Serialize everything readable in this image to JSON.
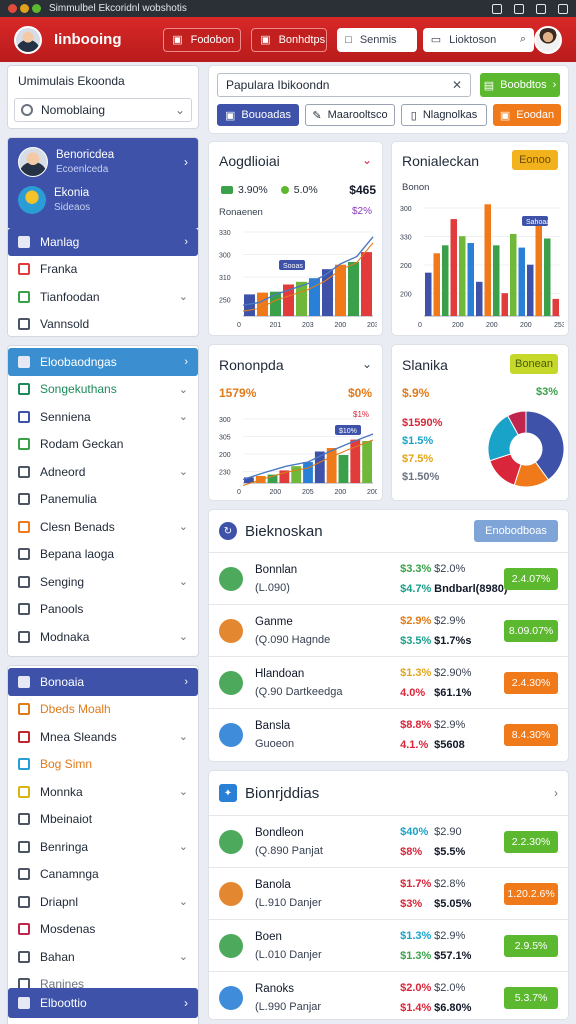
{
  "window": {
    "title": "Simmulbel Ekcoridnl wobshotis"
  },
  "header": {
    "app_title": "Iinbooing",
    "btn1": "Fodobon",
    "btn2": "Bonhdtps",
    "field1": "Senmis",
    "field2": "Lioktoson"
  },
  "sidebar": {
    "box1_title": "Umimulais Ekoonda",
    "box1_select": "Nomoblaing",
    "profile1_name": "Benoricdea",
    "profile1_sub": "Ecoenlceda",
    "profile2_name": "Ekonia",
    "profile2_sub": "Sideaos",
    "items_a": [
      {
        "label": "Manlag",
        "icon": "map-icon",
        "color": "#ffffff",
        "active": true
      },
      {
        "label": "Franka",
        "icon": "flag-icon",
        "color": "#e23b3b"
      },
      {
        "label": "Tianfoodan",
        "icon": "chart-icon",
        "color": "#3aa14a"
      },
      {
        "label": "Vannsold",
        "icon": "clock-icon",
        "color": "#4b5563"
      }
    ],
    "items_b": [
      {
        "label": "Eloobaodngas",
        "icon": "folder-icon",
        "active": true
      },
      {
        "label": "Songekuthans",
        "icon": "leaf-icon",
        "color": "#1e8a5a",
        "green": true
      },
      {
        "label": "Senniena",
        "icon": "home-icon",
        "color": "#3d52a8"
      },
      {
        "label": "Rodam Geckan",
        "icon": "star-icon",
        "color": "#3aa14a"
      },
      {
        "label": "Adneord",
        "icon": "doc-icon",
        "color": "#4b5563"
      },
      {
        "label": "Panemulia",
        "icon": "doc-icon",
        "color": "#4b5563"
      },
      {
        "label": "Clesn Benads",
        "icon": "dot-icon",
        "color": "#f07a1a"
      },
      {
        "label": "Bepana laoga",
        "icon": "doc-icon",
        "color": "#4b5563"
      },
      {
        "label": "Senging",
        "icon": "cart-icon",
        "color": "#4b5563"
      },
      {
        "label": "Panools",
        "icon": "info-icon",
        "color": "#4b5563"
      },
      {
        "label": "Modnaka",
        "icon": "grid-icon",
        "color": "#4b5563"
      }
    ],
    "items_c": [
      {
        "label": "Bonoaia",
        "icon": "folder-icon",
        "active": true
      },
      {
        "label": "Dbeds Moalh",
        "icon": "tag-icon",
        "color": "#e07b1a",
        "orange": true
      },
      {
        "label": "Mnea Sleands",
        "icon": "flag-icon",
        "color": "#c0262d"
      },
      {
        "label": "Bog Simn",
        "icon": "mail-icon",
        "color": "#2a9dd6",
        "orange": true
      },
      {
        "label": "Monnka",
        "icon": "dot-icon",
        "color": "#d9b51a"
      },
      {
        "label": "Mbeinaiot",
        "icon": "doc-icon",
        "color": "#4b5563"
      },
      {
        "label": "Benringa",
        "icon": "cal-icon",
        "color": "#4b5563"
      },
      {
        "label": "Canamnga",
        "icon": "grid-icon",
        "color": "#4b5563"
      },
      {
        "label": "Driapnl",
        "icon": "doc-icon",
        "color": "#4b5563"
      },
      {
        "label": "Mosdenas",
        "icon": "heart-icon",
        "color": "#c0264d"
      },
      {
        "label": "Bahan",
        "icon": "doc-icon",
        "color": "#4b5563"
      },
      {
        "label": "Ranines",
        "icon": "share-icon",
        "color": "#4b5563",
        "dim": true
      }
    ],
    "footer": "Elboottio"
  },
  "search": {
    "value": "Papulara Ibikoondn",
    "go_button": "Boobdtos",
    "btn_a": "Bouoadas",
    "btn_b": "Maarooltsco",
    "btn_c": "Nlagnolkas",
    "btn_d": "Eoodan"
  },
  "card1": {
    "title": "Aogdlioiai",
    "legend1": "3.90%",
    "legend2": "5.0%",
    "total": "$465",
    "sub": "Ronaenen",
    "right_val": "$2%",
    "badge": "Sooas",
    "yticks": [
      "330",
      "300",
      "310",
      "250"
    ],
    "xticks": [
      "0",
      "201",
      "203",
      "200",
      "203"
    ]
  },
  "card2": {
    "title": "Ronialeckan",
    "button": "Eonoo",
    "sub": "Bonon",
    "badge": "Sahoaa",
    "yticks": [
      "300",
      "330",
      "200",
      "200"
    ],
    "xticks": [
      "0",
      "200",
      "200",
      "200",
      "253"
    ]
  },
  "card3": {
    "title": "Rononpda",
    "value": "1579%",
    "right_val": "$0%",
    "annot": "$1%",
    "badge": "$10%",
    "yticks": [
      "300",
      "305",
      "200",
      "230"
    ],
    "xticks": [
      "0",
      "200",
      "205",
      "200",
      "200"
    ]
  },
  "card4": {
    "title": "Slanika",
    "button": "Bonean",
    "value": "$.9%",
    "right_val": "$3%",
    "legend": [
      {
        "label": "$1590%",
        "color": "#d9263a"
      },
      {
        "label": "$1.5%",
        "color": "#1aa3c9"
      },
      {
        "label": "$7.5%",
        "color": "#e0a61a"
      },
      {
        "label": "$1.50%",
        "color": "#6b7280"
      }
    ]
  },
  "list1": {
    "title": "Bieknoskan",
    "button": "Enobodboas",
    "rows": [
      {
        "name": "Bonnlan",
        "sub": "(L.090)",
        "v1": "$3.3%",
        "v2": "$2.0%",
        "v3": "$4.7%",
        "v4": "Bndbarl(8980)",
        "badge": "2.4.07%",
        "badge_color": "#5cb82e",
        "v1c": "#3aa14a",
        "v3c": "#1a9f8a"
      },
      {
        "name": "Ganme",
        "sub": "(Q.090 Hagnde",
        "v1": "$2.9%",
        "v2": "$2.9%",
        "v3": "$3.5%",
        "v4": "$1.7%s",
        "badge": "8.09.07%",
        "badge_color": "#5cb82e",
        "v1c": "#e07b1a",
        "v3c": "#1a9f8a"
      },
      {
        "name": "Hlandoan",
        "sub": "(Q.90 Dartkeedga",
        "v1": "$1.3%",
        "v2": "$2.90%",
        "v3": "4.0%",
        "v4": "$61.1%",
        "badge": "2.4.30%",
        "badge_color": "#f07a1a",
        "v1c": "#e0a61a",
        "v3c": "#d9263a"
      },
      {
        "name": "Bansla",
        "sub": "Guoeon",
        "v1": "$8.8%",
        "v2": "$2.9%",
        "v3": "4.1.%",
        "v4": "$5608",
        "badge": "8.4.30%",
        "badge_color": "#f07a1a",
        "v1c": "#d9263a",
        "v3c": "#d9263a"
      }
    ]
  },
  "list2": {
    "title": "Bionrjddias",
    "rows": [
      {
        "name": "Bondleon",
        "sub": "(Q.890 Panjat",
        "v1": "$40%",
        "v2": "$2.90",
        "v3": "$8%",
        "v4": "$5.5%",
        "badge": "2.2.30%",
        "badge_color": "#5cb82e",
        "v1c": "#1aa3c9",
        "v3c": "#d9263a"
      },
      {
        "name": "Banola",
        "sub": "(L.910 Danjer",
        "v1": "$1.7%",
        "v2": "$2.8%",
        "v3": "$3%",
        "v4": "$5.05%",
        "badge": "1.20.2.6%",
        "badge_color": "#f07a1a",
        "v1c": "#d9263a",
        "v3c": "#d9263a"
      },
      {
        "name": "Boen",
        "sub": "(L.010 Danjer",
        "v1": "$1.3%",
        "v2": "$2.9%",
        "v3": "$1.3%",
        "v4": "$57.1%",
        "badge": "2.9.5%",
        "badge_color": "#5cb82e",
        "v1c": "#1aa3c9",
        "v3c": "#3aa14a"
      },
      {
        "name": "Ranoks",
        "sub": "(L.990 Panjar",
        "v1": "$2.0%",
        "v2": "$2.0%",
        "v3": "$1.4%",
        "v4": "$6.80%",
        "badge": "5.3.7%",
        "badge_color": "#5cb82e",
        "v1c": "#d9263a",
        "v3c": "#d9263a"
      }
    ]
  },
  "chart_data": [
    {
      "type": "bar",
      "title": "Aogdlioiai",
      "series": [
        {
          "values": [
            24,
            26,
            27,
            35,
            38,
            42,
            52,
            57,
            60,
            71
          ]
        }
      ],
      "line": [
        12,
        15,
        24,
        30,
        36,
        45,
        58,
        66,
        88
      ]
    },
    {
      "type": "bar",
      "title": "Ronialeckan",
      "series": [
        {
          "values": [
            38,
            55,
            62,
            85,
            70,
            64,
            30,
            98,
            62,
            20,
            72,
            60,
            45,
            85,
            68,
            15
          ]
        }
      ]
    },
    {
      "type": "bar",
      "title": "Rononpda",
      "series": [
        {
          "values": [
            8,
            10,
            12,
            18,
            24,
            30,
            45,
            50,
            40,
            62,
            60
          ]
        }
      ],
      "line": [
        5,
        15,
        24,
        30,
        45,
        58,
        70
      ]
    },
    {
      "type": "pie",
      "title": "Slanika",
      "values": [
        40,
        15,
        15,
        22,
        8
      ]
    }
  ],
  "colors": {
    "header": "#d42424",
    "accent": "#3d52a8",
    "green": "#5cb82e",
    "orange": "#f07a1a"
  }
}
